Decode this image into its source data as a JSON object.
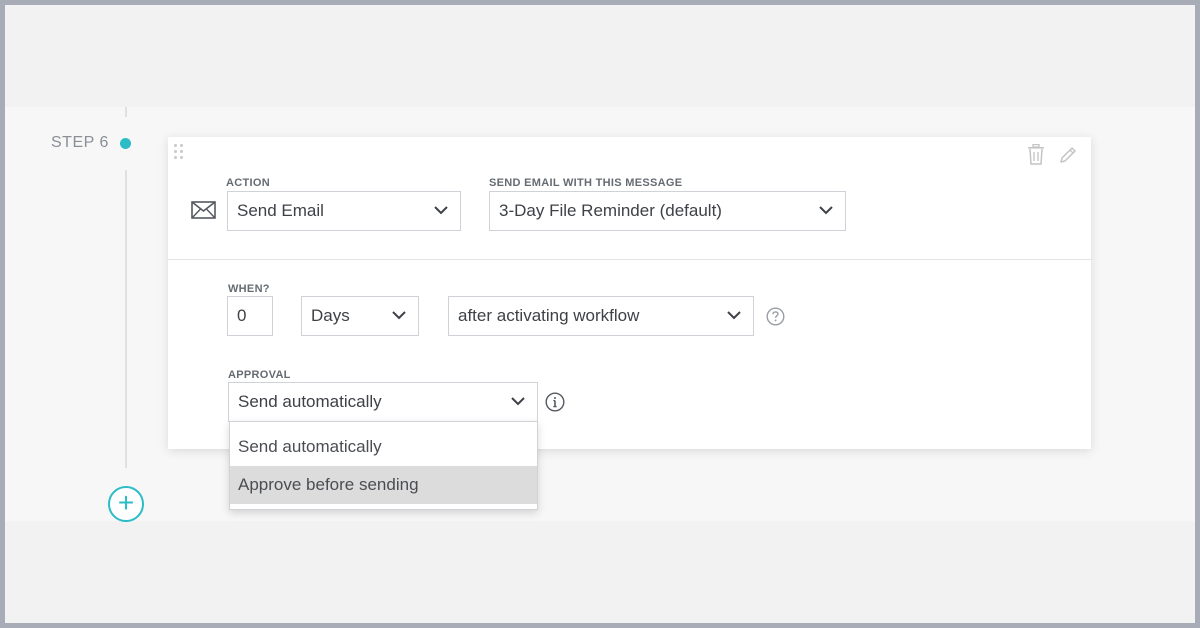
{
  "step": {
    "label": "STEP 6",
    "accent_color": "#2bbcc6"
  },
  "toolbar": {
    "delete_icon": "trash-icon",
    "edit_icon": "pencil-icon",
    "drag_icon": "drag-handle-icon"
  },
  "action": {
    "icon": "envelope-icon",
    "label": "ACTION",
    "value": "Send Email"
  },
  "message": {
    "label": "SEND EMAIL WITH THIS MESSAGE",
    "value": "3-Day File Reminder (default)"
  },
  "when": {
    "label": "WHEN?",
    "amount": "0",
    "unit": "Days",
    "trigger": "after activating workflow",
    "help_icon": "question-circle-icon"
  },
  "approval": {
    "label": "APPROVAL",
    "value": "Send automatically",
    "info_icon": "info-circle-icon",
    "options": [
      {
        "label": "Send automatically"
      },
      {
        "label": "Approve before sending"
      }
    ],
    "highlighted_option": "Approve before sending"
  },
  "add_step": {
    "symbol": "+",
    "icon": "plus-circle-icon"
  }
}
